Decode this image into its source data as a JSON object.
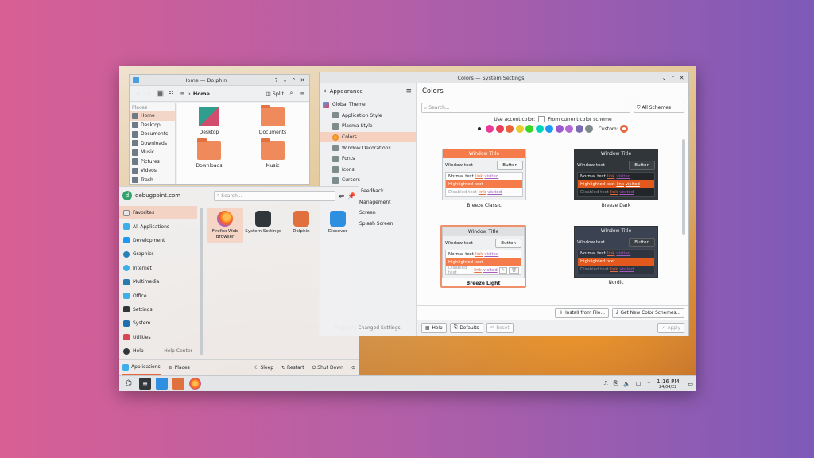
{
  "dolphin": {
    "title": "Home — Dolphin",
    "breadcrumb": "Home",
    "split_label": "Split",
    "places_heading": "Places",
    "places": [
      "Home",
      "Desktop",
      "Documents",
      "Downloads",
      "Music",
      "Pictures",
      "Videos",
      "Trash"
    ],
    "folders": [
      "Desktop",
      "Documents",
      "Downloads",
      "Music"
    ]
  },
  "launcher": {
    "user": "debugpoint.com",
    "avatar_letter": "d",
    "search_placeholder": "Search...",
    "categories": [
      "Favorites",
      "All Applications",
      "Development",
      "Graphics",
      "Internet",
      "Multimedia",
      "Office",
      "Settings",
      "System",
      "Utilities",
      "Help"
    ],
    "help_center": "Help Center",
    "apps": [
      "Firefox Web Browser",
      "System Settings",
      "Dolphin",
      "Discover"
    ],
    "footer": {
      "applications": "Applications",
      "places": "Places",
      "sleep": "Sleep",
      "restart": "Restart",
      "shutdown": "Shut Down"
    }
  },
  "settings": {
    "title": "Colors — System Settings",
    "section": "Appearance",
    "nav": [
      "Global Theme",
      "Application Style",
      "Plasma Style",
      "Colors",
      "Window Decorations",
      "Fonts",
      "Icons",
      "Cursors",
      "Feedback",
      "Management",
      "Screen",
      "Splash Screen"
    ],
    "highlight_changed": "Highlight Changed Settings",
    "page_title": "Colors",
    "search_placeholder": "Search...",
    "filter": "All Schemes",
    "accent_label": "Use accent color:",
    "from_scheme": "From current color scheme",
    "custom_label": "Custom:",
    "accent_colors": [
      "#e93a9a",
      "#e93d58",
      "#e9643a",
      "#e8cb2d",
      "#3dd425",
      "#00d3b8",
      "#1d99f3",
      "#9b59d0",
      "#b568d5",
      "#7b6bb0",
      "#7e8b8c"
    ],
    "schemes": [
      {
        "name": "Breeze Classic"
      },
      {
        "name": "Breeze Dark"
      },
      {
        "name": "Breeze Light"
      },
      {
        "name": "Nordic"
      }
    ],
    "preview": {
      "window_title": "Window Title",
      "window_text": "Window text",
      "button": "Button",
      "normal": "Normal text",
      "highlighted": "Highlighted text",
      "disabled": "Disabled text",
      "link": "link",
      "visited": "visited"
    },
    "buttons": {
      "install": "Install from File...",
      "get_new": "Get New Color Schemes...",
      "help": "Help",
      "defaults": "Defaults",
      "reset": "Reset",
      "apply": "Apply"
    }
  },
  "taskbar": {
    "time": "1:16 PM",
    "date": "24/04/22"
  }
}
